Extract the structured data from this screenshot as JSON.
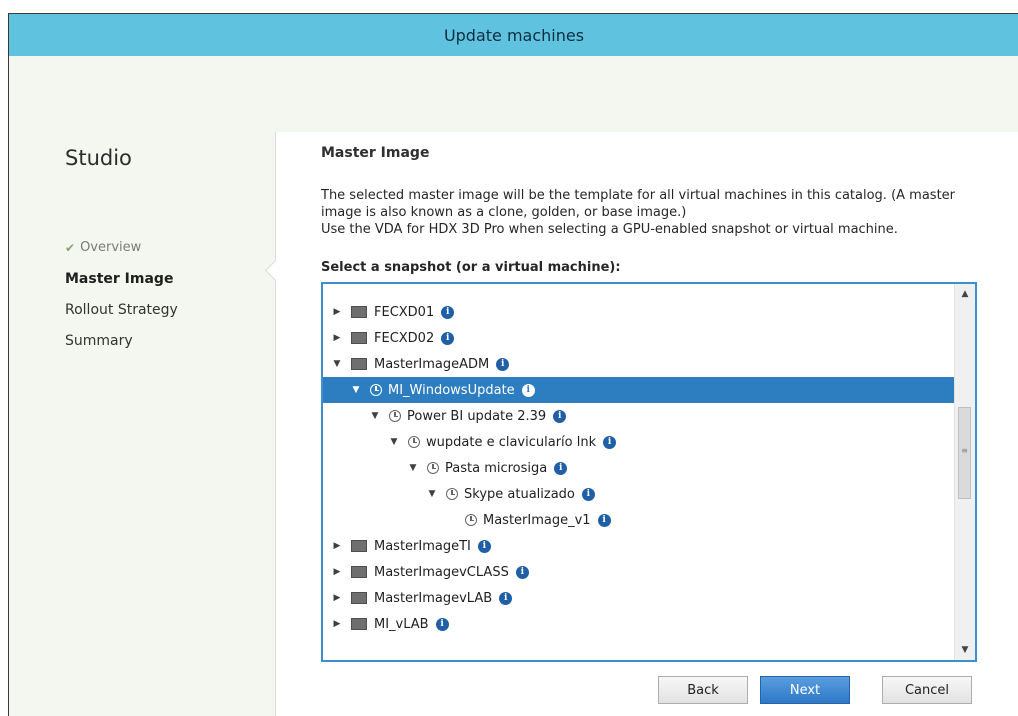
{
  "window": {
    "title": "Update machines"
  },
  "sidebar": {
    "app_name": "Studio",
    "steps": [
      {
        "label": "Overview",
        "state": "done",
        "icon": "check-icon"
      },
      {
        "label": "Master Image",
        "state": "active"
      },
      {
        "label": "Rollout Strategy",
        "state": "pending"
      },
      {
        "label": "Summary",
        "state": "pending"
      }
    ]
  },
  "main": {
    "heading": "Master Image",
    "description_line1": "The selected master image will be the template for all virtual machines in this catalog. (A master image is also known as a clone, golden, or base image.)",
    "description_line2": "Use the VDA for HDX 3D Pro when selecting a GPU-enabled snapshot or virtual machine.",
    "select_label": "Select a snapshot (or a virtual machine):"
  },
  "tree": {
    "items": [
      {
        "label": "FECXD01",
        "level": 0,
        "type": "vm",
        "expander": "collapsed"
      },
      {
        "label": "FECXD02",
        "level": 0,
        "type": "vm",
        "expander": "collapsed"
      },
      {
        "label": "MasterImageADM",
        "level": 0,
        "type": "vm",
        "expander": "expanded"
      },
      {
        "label": "MI_WindowsUpdate",
        "level": 1,
        "type": "snapshot",
        "expander": "expanded",
        "selected": true
      },
      {
        "label": "Power BI update 2.39",
        "level": 2,
        "type": "snapshot",
        "expander": "expanded"
      },
      {
        "label": "wupdate e clavicularío lnk",
        "level": 3,
        "type": "snapshot",
        "expander": "expanded"
      },
      {
        "label": "Pasta microsiga",
        "level": 4,
        "type": "snapshot",
        "expander": "expanded"
      },
      {
        "label": "Skype atualizado",
        "level": 5,
        "type": "snapshot",
        "expander": "expanded"
      },
      {
        "label": "MasterImage_v1",
        "level": 6,
        "type": "snapshot",
        "expander": "none"
      },
      {
        "label": "MasterImageTI",
        "level": 0,
        "type": "vm",
        "expander": "collapsed"
      },
      {
        "label": "MasterImagevCLASS",
        "level": 0,
        "type": "vm",
        "expander": "collapsed"
      },
      {
        "label": "MasterImagevLAB",
        "level": 0,
        "type": "vm",
        "expander": "collapsed"
      },
      {
        "label": "MI_vLAB",
        "level": 0,
        "type": "vm",
        "expander": "collapsed"
      }
    ]
  },
  "buttons": {
    "back": "Back",
    "next": "Next",
    "cancel": "Cancel"
  },
  "colors": {
    "titlebar": "#5fc3e0",
    "selection": "#2d7ec0",
    "primary_button": "#2f78c8",
    "info_icon": "#1f5fa6"
  }
}
